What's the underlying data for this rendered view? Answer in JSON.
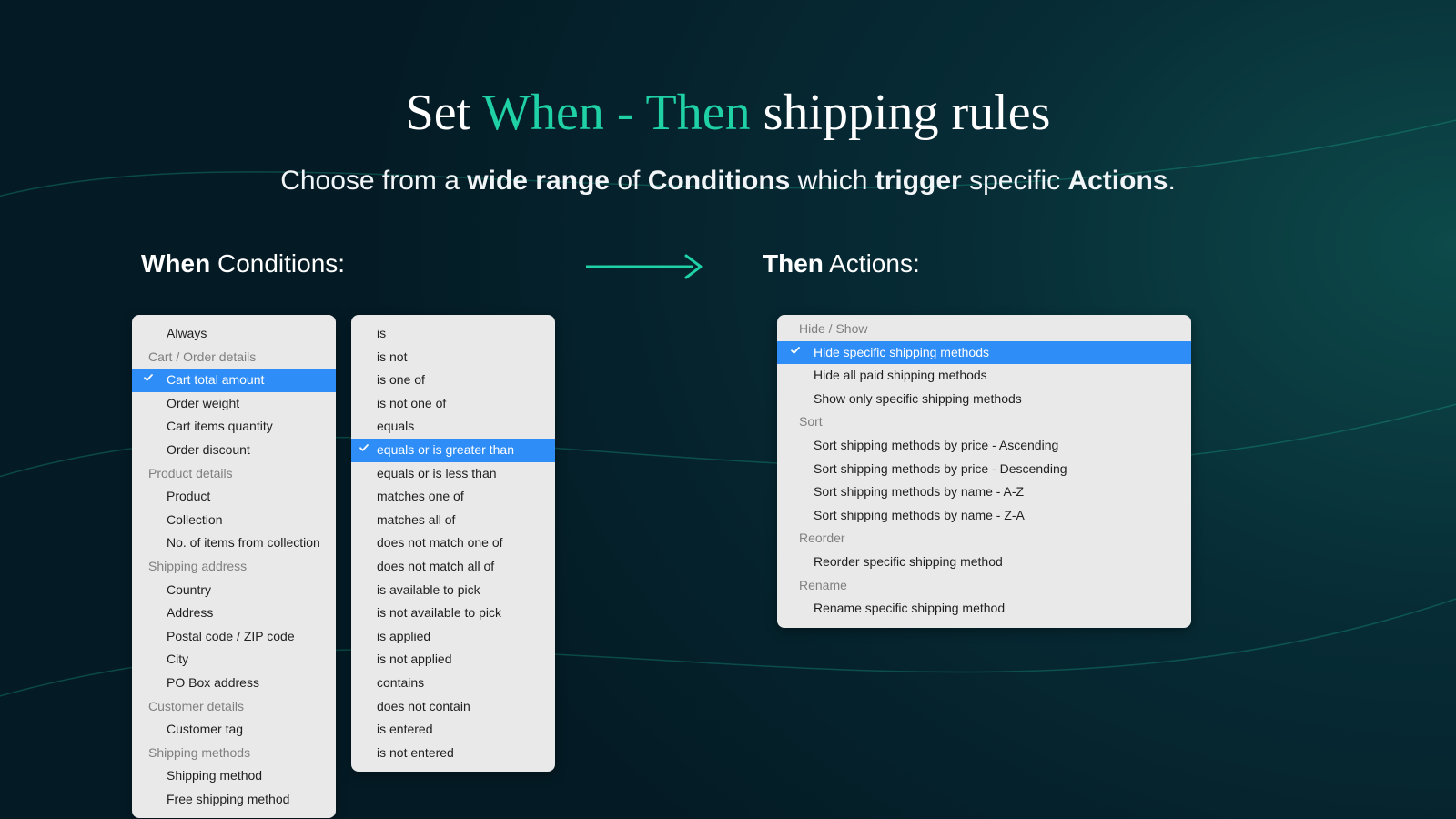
{
  "heading": {
    "part1": "Set ",
    "highlight": "When - Then",
    "part2": " shipping rules"
  },
  "subheading": {
    "text1": "Choose from a ",
    "b1": "wide range",
    "text2": " of ",
    "b2": "Conditions",
    "text3": " which ",
    "b3": "trigger",
    "text4": " specific ",
    "b4": "Actions",
    "text5": "."
  },
  "labels": {
    "when_bold": "When",
    "when_rest": " Conditions:",
    "then_bold": "Then",
    "then_rest": " Actions:"
  },
  "conditions": [
    {
      "kind": "item",
      "label": "Always"
    },
    {
      "kind": "header",
      "label": "Cart / Order details"
    },
    {
      "kind": "item",
      "label": "Cart total amount",
      "selected": true
    },
    {
      "kind": "item",
      "label": "Order weight"
    },
    {
      "kind": "item",
      "label": "Cart items quantity"
    },
    {
      "kind": "item",
      "label": "Order discount"
    },
    {
      "kind": "header",
      "label": "Product details"
    },
    {
      "kind": "item",
      "label": "Product"
    },
    {
      "kind": "item",
      "label": "Collection"
    },
    {
      "kind": "item",
      "label": "No. of items from collection"
    },
    {
      "kind": "header",
      "label": "Shipping address"
    },
    {
      "kind": "item",
      "label": "Country"
    },
    {
      "kind": "item",
      "label": "Address"
    },
    {
      "kind": "item",
      "label": "Postal code / ZIP code"
    },
    {
      "kind": "item",
      "label": "City"
    },
    {
      "kind": "item",
      "label": "PO Box address"
    },
    {
      "kind": "header",
      "label": "Customer details"
    },
    {
      "kind": "item",
      "label": "Customer tag"
    },
    {
      "kind": "header",
      "label": "Shipping methods"
    },
    {
      "kind": "item",
      "label": "Shipping method"
    },
    {
      "kind": "item",
      "label": "Free shipping method"
    }
  ],
  "operators": [
    {
      "kind": "item",
      "label": "is"
    },
    {
      "kind": "item",
      "label": "is not"
    },
    {
      "kind": "item",
      "label": "is one of"
    },
    {
      "kind": "item",
      "label": "is not one of"
    },
    {
      "kind": "item",
      "label": "equals"
    },
    {
      "kind": "item",
      "label": "equals or is greater than",
      "selected": true
    },
    {
      "kind": "item",
      "label": "equals or is less than"
    },
    {
      "kind": "item",
      "label": "matches one of"
    },
    {
      "kind": "item",
      "label": "matches all of"
    },
    {
      "kind": "item",
      "label": "does not match one of"
    },
    {
      "kind": "item",
      "label": "does not match all of"
    },
    {
      "kind": "item",
      "label": "is available to pick"
    },
    {
      "kind": "item",
      "label": "is not available to pick"
    },
    {
      "kind": "item",
      "label": "is applied"
    },
    {
      "kind": "item",
      "label": "is not applied"
    },
    {
      "kind": "item",
      "label": "contains"
    },
    {
      "kind": "item",
      "label": "does not contain"
    },
    {
      "kind": "item",
      "label": "is entered"
    },
    {
      "kind": "item",
      "label": "is not entered"
    }
  ],
  "actions": [
    {
      "kind": "header",
      "label": "Hide / Show"
    },
    {
      "kind": "item",
      "label": "Hide specific shipping methods",
      "selected": true
    },
    {
      "kind": "item",
      "label": "Hide all paid shipping methods"
    },
    {
      "kind": "item",
      "label": "Show only specific shipping methods"
    },
    {
      "kind": "header",
      "label": "Sort"
    },
    {
      "kind": "item",
      "label": "Sort shipping methods by price - Ascending"
    },
    {
      "kind": "item",
      "label": "Sort shipping methods by price - Descending"
    },
    {
      "kind": "item",
      "label": "Sort shipping methods by name - A-Z"
    },
    {
      "kind": "item",
      "label": "Sort shipping methods by name - Z-A"
    },
    {
      "kind": "header",
      "label": "Reorder"
    },
    {
      "kind": "item",
      "label": "Reorder specific shipping method"
    },
    {
      "kind": "header",
      "label": "Rename"
    },
    {
      "kind": "item",
      "label": "Rename specific shipping method"
    }
  ]
}
